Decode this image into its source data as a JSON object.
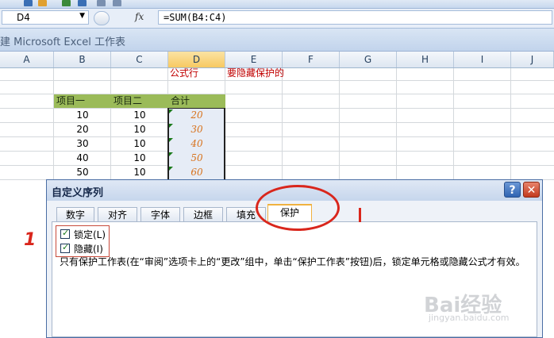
{
  "formula_bar": {
    "name_box": "D4",
    "fx_label": "fx",
    "formula": "=SUM(B4:C4)"
  },
  "workbook": {
    "title": "建 Microsoft Excel 工作表"
  },
  "columns": [
    "A",
    "B",
    "C",
    "D",
    "E",
    "F",
    "G",
    "H",
    "I",
    "J"
  ],
  "sheet": {
    "annotation_d1": "公式行",
    "annotation_e1": "要隐藏保护的",
    "headers": [
      "项目一",
      "项目二",
      "合计"
    ],
    "rows": [
      {
        "b": "10",
        "c": "10",
        "d": "20"
      },
      {
        "b": "20",
        "c": "10",
        "d": "30"
      },
      {
        "b": "30",
        "c": "10",
        "d": "40"
      },
      {
        "b": "40",
        "c": "10",
        "d": "50"
      },
      {
        "b": "50",
        "c": "10",
        "d": "60"
      }
    ]
  },
  "dialog": {
    "title": "自定义序列",
    "help": "?",
    "close": "✕",
    "tabs": [
      "数字",
      "对齐",
      "字体",
      "边框",
      "填充",
      "保护"
    ],
    "active_tab": "保护",
    "locked_label": "锁定(L)",
    "hidden_label": "隐藏(I)",
    "locked_checked": true,
    "hidden_checked": true,
    "description": "只有保护工作表(在“审阅”选项卡上的“更改”组中，单击“保护工作表”按钮)后，锁定单元格或隐藏公式才有效。"
  },
  "annotations": {
    "mark_one": "1",
    "mark_two": "1"
  },
  "watermark": {
    "brand": "Bai经验",
    "url": "jingyan.baidu.com"
  },
  "colors": {
    "header_green": "#9bbb59",
    "accent_red": "#d9261c",
    "total_orange": "#d8721c"
  }
}
